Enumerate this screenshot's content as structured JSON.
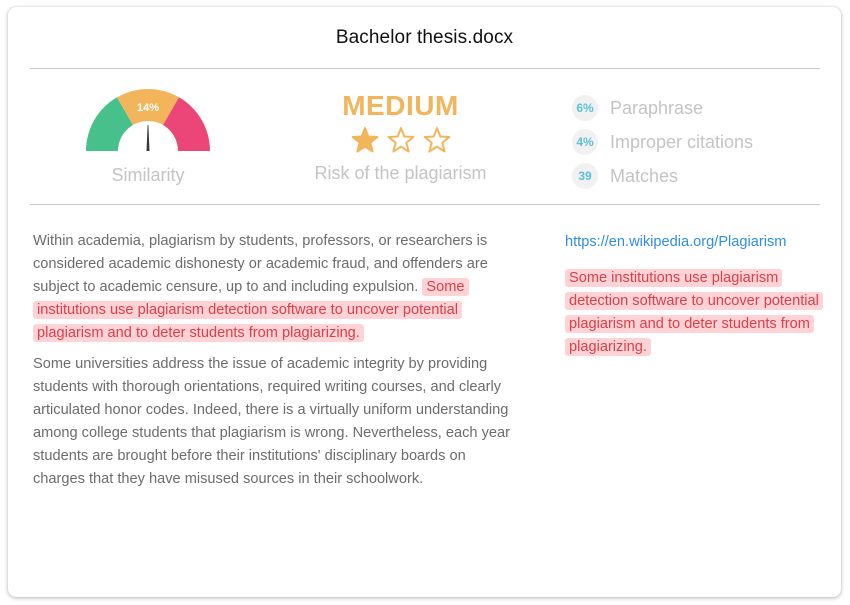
{
  "document": {
    "title": "Bachelor thesis.docx"
  },
  "similarity": {
    "value_percent": 14,
    "value_label": "14%",
    "label": "Similarity",
    "segments": [
      {
        "name": "low",
        "color": "#47c08c"
      },
      {
        "name": "medium",
        "color": "#f2b55c"
      },
      {
        "name": "high",
        "color": "#ec4679"
      }
    ]
  },
  "risk": {
    "level": "MEDIUM",
    "stars_filled": 1,
    "stars_total": 3,
    "label": "Risk of the plagiarism",
    "color": "#f2b55c"
  },
  "stats": [
    {
      "badge": "6%",
      "label": "Paraphrase"
    },
    {
      "badge": "4%",
      "label": "Improper citations"
    },
    {
      "badge": "39",
      "label": "Matches"
    }
  ],
  "content": {
    "paragraph1_plain": "Within academia, plagiarism by students, professors, or researchers is considered academic dishonesty or academic fraud, and offenders are subject to academic censure, up to and including expulsion. ",
    "paragraph1_highlight": "Some institutions use plagiarism detection software to uncover potential plagiarism and to deter students from plagiarizing.",
    "paragraph2": "Some universities address the issue of academic integrity by providing students with thorough orientations, required writing courses, and clearly articulated honor codes. Indeed, there is a virtually uniform understanding among college students that plagiarism is wrong. Nevertheless, each year students are brought before their institutions' disciplinary boards on charges that they have misused sources in their schoolwork."
  },
  "source": {
    "url": "https://en.wikipedia.org/Plagiarism",
    "matched_text": "Some institutions use plagiarism detection software to uncover potential plagiarism and to deter students from plagiarizing."
  },
  "colors": {
    "highlight_bg": "#ffd3d6",
    "highlight_text": "#d8404a",
    "link": "#2f8ee0",
    "badge_text": "#5bbfd6"
  }
}
